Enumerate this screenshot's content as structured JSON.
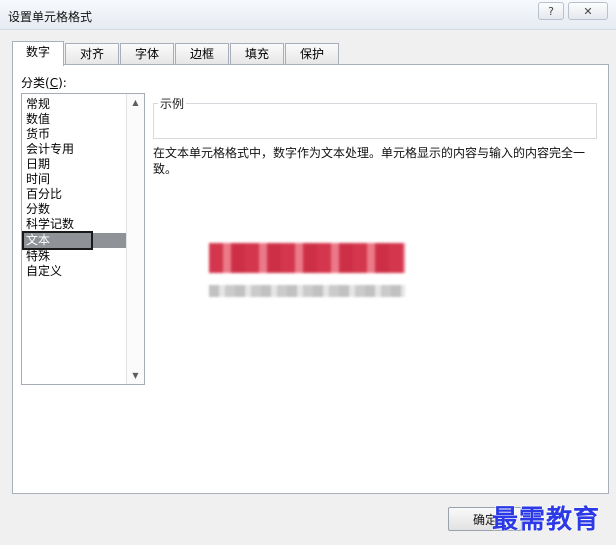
{
  "window": {
    "title": "设置单元格格式",
    "help_label": "?",
    "close_label": "✕"
  },
  "tabs": [
    {
      "label": "数字",
      "active": true
    },
    {
      "label": "对齐",
      "active": false
    },
    {
      "label": "字体",
      "active": false
    },
    {
      "label": "边框",
      "active": false
    },
    {
      "label": "填充",
      "active": false
    },
    {
      "label": "保护",
      "active": false
    }
  ],
  "category": {
    "label_prefix": "分类(",
    "accelerator": "C",
    "label_suffix": "):",
    "items": [
      "常规",
      "数值",
      "货币",
      "会计专用",
      "日期",
      "时间",
      "百分比",
      "分数",
      "科学记数",
      "文本",
      "特殊",
      "自定义"
    ],
    "selected": "文本"
  },
  "sample": {
    "label": "示例"
  },
  "description": "在文本单元格格式中，数字作为文本处理。单元格显示的内容与输入的内容完全一致。",
  "buttons": {
    "ok": "确定"
  },
  "watermark": "最需教育",
  "icons": {
    "scroll_up": "triangle-up-icon",
    "scroll_down": "triangle-down-icon"
  }
}
